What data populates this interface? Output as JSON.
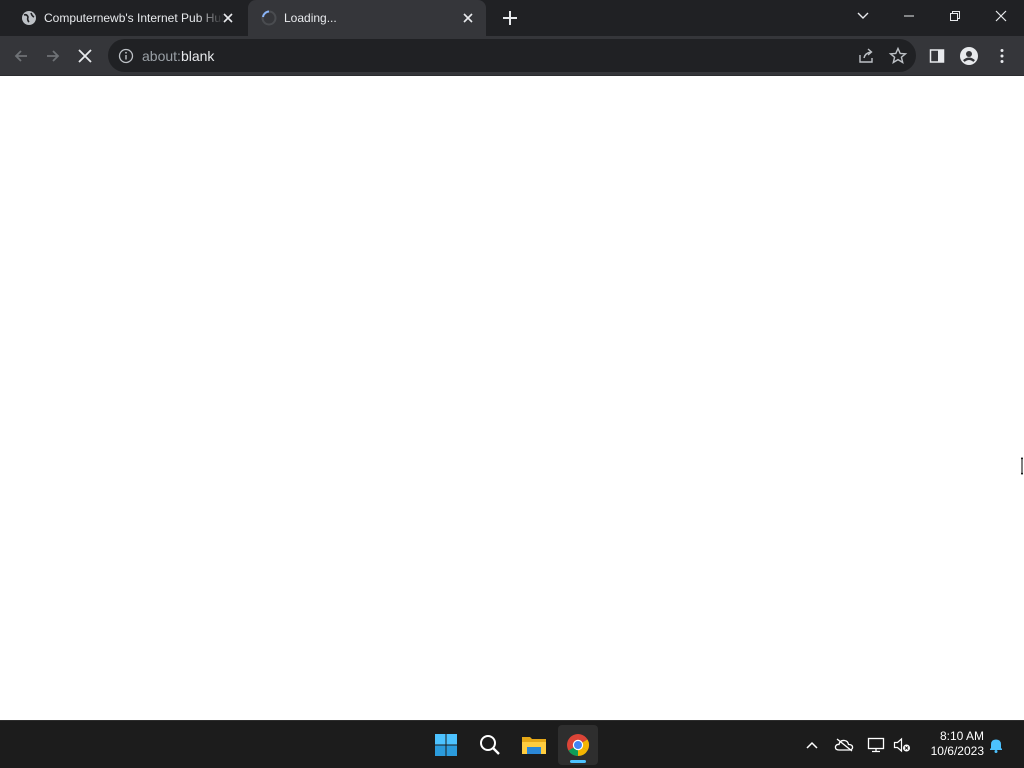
{
  "browser": {
    "tabs": [
      {
        "title": "Computernewb's Internet Pub Hub",
        "favicon": "globe-icon",
        "active": false
      },
      {
        "title": "Loading...",
        "favicon": "spinner-icon",
        "active": true
      }
    ],
    "address_bar": {
      "scheme": "about:",
      "path": "blank"
    },
    "colors": {
      "titlebar": "#202124",
      "toolbar": "#35363a",
      "omnibox": "#202124",
      "text": "#e8eaed",
      "page": "#ffffff"
    }
  },
  "taskbar": {
    "apps": [
      "windows-start-icon",
      "search-icon",
      "file-explorer-icon",
      "chrome-icon"
    ],
    "clock": {
      "time": "8:10 AM",
      "date": "10/6/2023"
    },
    "colors": {
      "background": "#1c1c1c",
      "accent": "#4cc2ff"
    }
  }
}
